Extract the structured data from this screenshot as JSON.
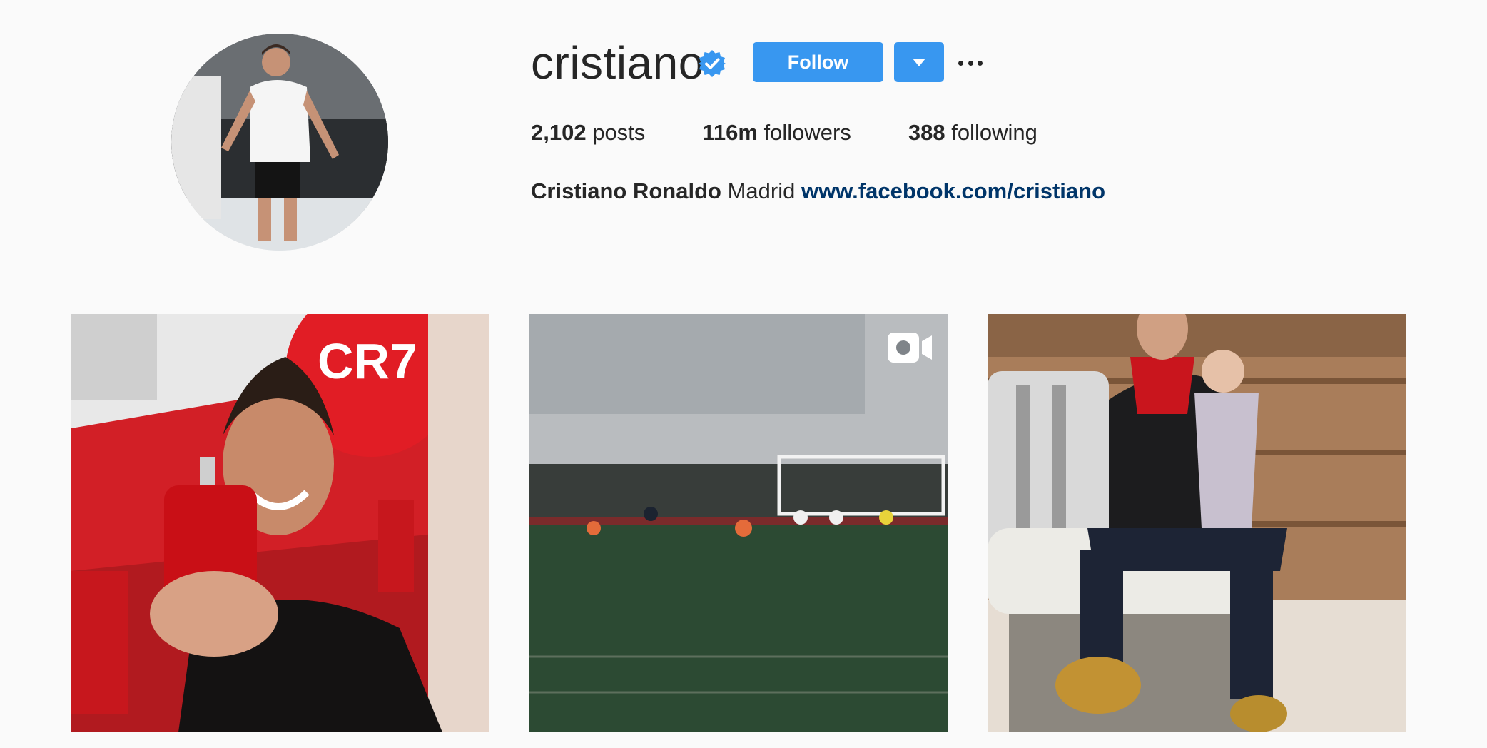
{
  "profile": {
    "username": "cristiano",
    "verified_icon": "verified-badge-icon",
    "follow_label": "Follow",
    "dropdown_icon": "caret-down-icon",
    "more_icon": "more-options-icon",
    "stats": {
      "posts_count": "2,102",
      "posts_label": "posts",
      "followers_count": "116m",
      "followers_label": "followers",
      "following_count": "388",
      "following_label": "following"
    },
    "bio": {
      "full_name": "Cristiano Ronaldo",
      "location": "Madrid",
      "website": "www.facebook.com/cristiano"
    }
  },
  "posts": [
    {
      "type": "photo",
      "overlay_text": "CR7"
    },
    {
      "type": "video",
      "badge_icon": "video-camera-icon"
    },
    {
      "type": "photo"
    }
  ],
  "colors": {
    "background": "#fafafa",
    "button_blue": "#3897f0",
    "link_blue": "#003569",
    "verified_blue": "#3897f0",
    "text": "#262626"
  }
}
